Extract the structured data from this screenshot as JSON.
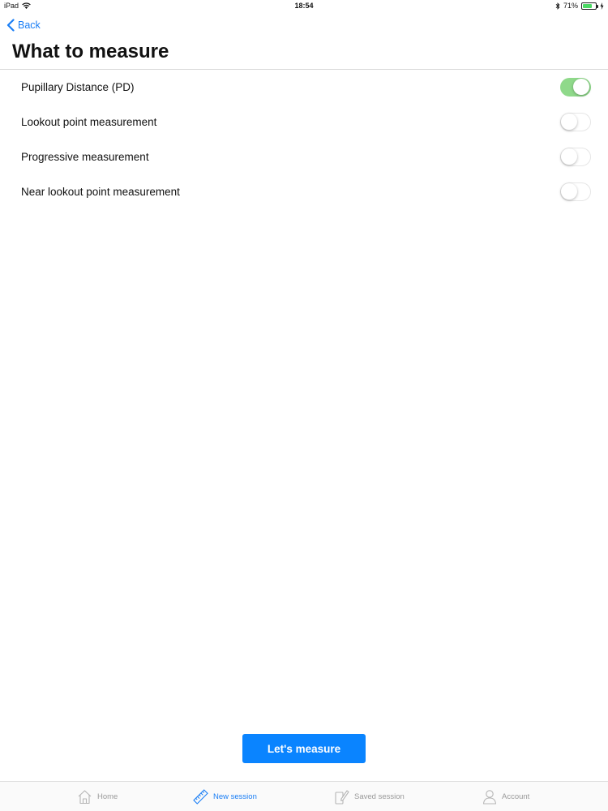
{
  "status_bar": {
    "device": "iPad",
    "time": "18:54",
    "battery_percent": "71%",
    "battery_level": 0.71,
    "icons": [
      "wifi-icon",
      "bluetooth-icon",
      "battery-icon",
      "charging-icon"
    ]
  },
  "nav": {
    "back_label": "Back",
    "title": "What to measure"
  },
  "options": [
    {
      "label": "Pupillary Distance (PD)",
      "enabled": true
    },
    {
      "label": "Lookout point measurement",
      "enabled": false
    },
    {
      "label": "Progressive measurement",
      "enabled": false
    },
    {
      "label": "Near lookout point measurement",
      "enabled": false
    }
  ],
  "primary_action": {
    "label": "Let's measure"
  },
  "tab_bar": {
    "active": "New session",
    "tabs": [
      {
        "label": "Home",
        "icon": "home-icon"
      },
      {
        "label": "New session",
        "icon": "ruler-icon"
      },
      {
        "label": "Saved session",
        "icon": "tablet-pen-icon"
      },
      {
        "label": "Account",
        "icon": "person-icon"
      }
    ]
  },
  "colors": {
    "accent": "#1a7ef5",
    "button": "#0a84ff",
    "toggle_on": "#8fd98a",
    "tab_inactive": "#9a9a9a"
  }
}
